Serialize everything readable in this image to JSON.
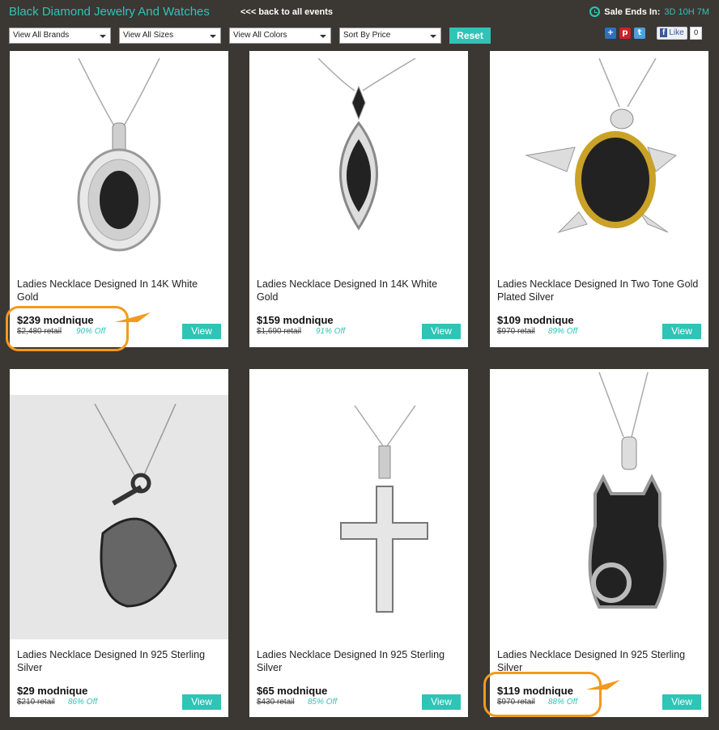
{
  "header": {
    "title": "Black Diamond Jewelry And Watches",
    "back_link": "<<< back to all events",
    "sale_label": "Sale Ends In:",
    "sale_time": "3D 10H 7M"
  },
  "filters": {
    "brands": "View All Brands",
    "sizes": "View All Sizes",
    "colors": "View All Colors",
    "sort": "Sort By Price",
    "reset": "Reset"
  },
  "social": {
    "like": "Like",
    "like_count": "0"
  },
  "products": [
    {
      "name": "Ladies Necklace Designed In 14K White Gold",
      "price": "$239 modnique",
      "retail": "$2,480 retail",
      "off": "90% Off",
      "view": "View"
    },
    {
      "name": "Ladies Necklace Designed In 14K White Gold",
      "price": "$159 modnique",
      "retail": "$1,690 retail",
      "off": "91% Off",
      "view": "View"
    },
    {
      "name": "Ladies Necklace Designed In Two Tone Gold Plated Silver",
      "price": "$109 modnique",
      "retail": "$970 retail",
      "off": "89% Off",
      "view": "View"
    },
    {
      "name": "Ladies Necklace Designed In 925 Sterling Silver",
      "price": "$29 modnique",
      "retail": "$210 retail",
      "off": "86% Off",
      "view": "View"
    },
    {
      "name": "Ladies Necklace Designed In 925 Sterling Silver",
      "price": "$65 modnique",
      "retail": "$430 retail",
      "off": "85% Off",
      "view": "View"
    },
    {
      "name": "Ladies Necklace Designed In 925 Sterling Silver",
      "price": "$119 modnique",
      "retail": "$970 retail",
      "off": "88% Off",
      "view": "View"
    }
  ],
  "colors": {
    "accent": "#2ec4b6",
    "background": "#3b3733",
    "highlight": "#f39a1e"
  }
}
